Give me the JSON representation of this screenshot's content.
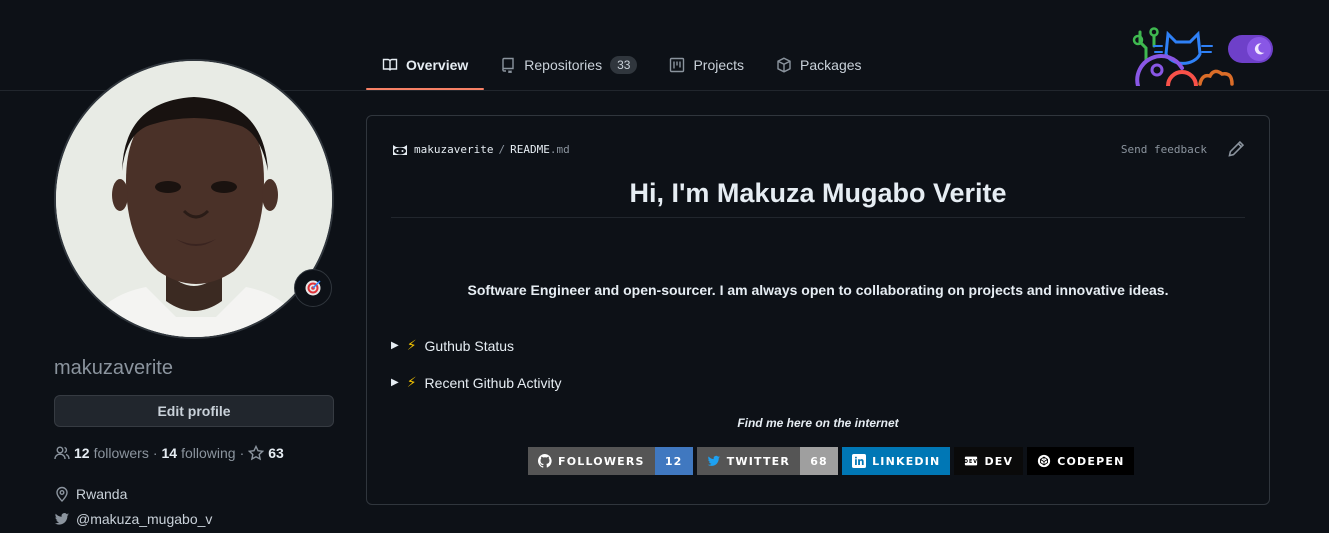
{
  "tabs": [
    {
      "label": "Overview",
      "icon": "book-icon",
      "active": true
    },
    {
      "label": "Repositories",
      "icon": "repo-icon",
      "count": "33"
    },
    {
      "label": "Projects",
      "icon": "project-icon"
    },
    {
      "label": "Packages",
      "icon": "package-icon"
    }
  ],
  "profile": {
    "username": "makuzaverite",
    "edit_label": "Edit profile",
    "followers_count": "12",
    "followers_label": "followers",
    "following_count": "14",
    "following_label": "following",
    "stars_count": "63",
    "location": "Rwanda",
    "twitter": "@makuza_mugabo_v",
    "status_icon": "direct-hit-icon"
  },
  "readme": {
    "owner": "makuzaverite",
    "separator": "/",
    "file": "README",
    "ext": ".md",
    "feedback_label": "Send feedback",
    "title": "Hi, I'm Makuza Mugabo Verite",
    "description": "Software Engineer and open-sourcer. I am always open to collaborating on projects and innovative ideas.",
    "sections": [
      "Guthub Status",
      "Recent Github Activity"
    ],
    "find_me": "Find me here on the internet",
    "badges": [
      {
        "label": "FOLLOWERS",
        "value": "12",
        "icon": "github-icon",
        "left_color": "#555555",
        "right_color": "#4078c0"
      },
      {
        "label": "TWITTER",
        "value": "68",
        "icon": "twitter-icon",
        "left_color": "#555555",
        "right_color": "#9f9f9f"
      },
      {
        "label": "LINKEDIN",
        "icon": "linkedin-icon",
        "left_color": "#0077b5"
      },
      {
        "label": "DEV",
        "icon": "dev-icon",
        "left_color": "#0a0a0a"
      },
      {
        "label": "CODEPEN",
        "icon": "codepen-icon",
        "left_color": "#000000"
      }
    ]
  },
  "colors": {
    "background": "#0d1117",
    "accent_underline": "#f78166",
    "toggle": "#6e40c9"
  }
}
